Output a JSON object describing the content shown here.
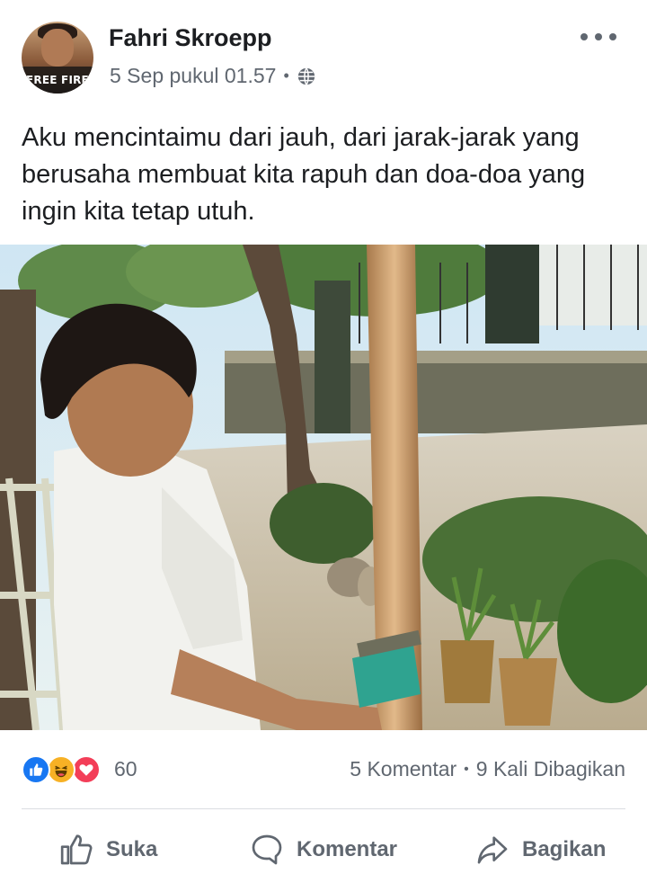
{
  "post": {
    "author": {
      "name": "Fahri Skroepp",
      "avatar_badge": "FREE FIRE"
    },
    "timestamp": "5 Sep pukul 01.57",
    "meta_separator": "•",
    "privacy_icon": "globe-icon",
    "more_icon": "more-horizontal-icon",
    "text": "Aku mencintaimu dari jauh, dari jarak-jarak yang berusaha membuat kita rapuh dan doa-doa yang ingin kita tetap utuh."
  },
  "reactions": {
    "icons": [
      "like-reaction-icon",
      "haha-reaction-icon",
      "love-reaction-icon"
    ],
    "count": "60",
    "comments": "5 Komentar",
    "separator": "•",
    "shares": "9 Kali Dibagikan"
  },
  "actions": {
    "like": "Suka",
    "comment": "Komentar",
    "share": "Bagikan"
  },
  "colors": {
    "text_primary": "#1c1e21",
    "text_secondary": "#606770",
    "like_blue": "#1877f2",
    "haha_yellow": "#f7b125",
    "love_red": "#f33e58",
    "divider": "#dadde1"
  }
}
